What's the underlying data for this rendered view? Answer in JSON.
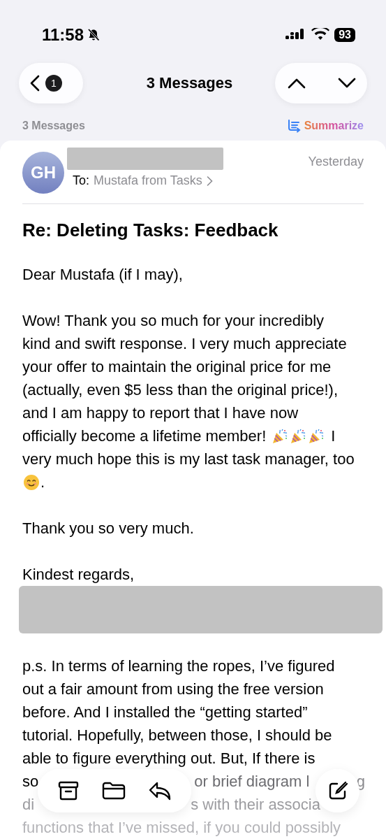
{
  "status_bar": {
    "time": "11:58",
    "silent": true,
    "battery": "93"
  },
  "nav": {
    "unread_count": "1",
    "title": "3 Messages"
  },
  "thread_bar": {
    "count": "3 Messages",
    "summarize": "Summarize"
  },
  "message": {
    "avatar": "GH",
    "to_label": "To:",
    "recipient": "Mustafa from Tasks",
    "date": "Yesterday",
    "subject": "Re: Deleting Tasks: Feedback",
    "body": [
      {
        "kind": "lines",
        "lines": [
          [
            "Dear Mustafa (if I may),"
          ]
        ]
      },
      {
        "kind": "lines",
        "lines": [
          [
            "Wow! Thank you so much for your incredibly"
          ],
          [
            "kind and swift response. I very much appreciate"
          ],
          [
            "your offer to maintain the original price for me"
          ],
          [
            "(actually, even $5 less than the original price!),"
          ],
          [
            "and I am happy to report that I have now"
          ],
          [
            "officially become a lifetime member!",
            {
              "kind": "popper"
            },
            {
              "kind": "popper"
            },
            {
              "kind": "popper"
            },
            "I"
          ],
          [
            "very much hope this is my last task manager, too"
          ],
          [
            {
              "kind": "smile"
            },
            "."
          ]
        ]
      },
      {
        "kind": "lines",
        "lines": [
          [
            "Thank you so very much."
          ]
        ]
      },
      {
        "kind": "lines",
        "lines": [
          [
            "Kindest regards,"
          ]
        ]
      },
      {
        "kind": "redacted"
      },
      {
        "kind": "lines",
        "lines": [
          [
            "p.s. In terms of learning the ropes, I’ve figured"
          ],
          [
            "out a fair amount from using the free version"
          ],
          [
            "before. And I installed the “getting started”"
          ],
          [
            "tutorial. Hopefully, between those, I should be"
          ],
          [
            "able to figure everything out. But, If there is"
          ],
          [
            "so",
            "or brief diagram l",
            "g"
          ],
          [
            "di",
            "s with their associa"
          ],
          [
            "functions that I’ve missed, if you could possibly"
          ]
        ]
      }
    ]
  }
}
